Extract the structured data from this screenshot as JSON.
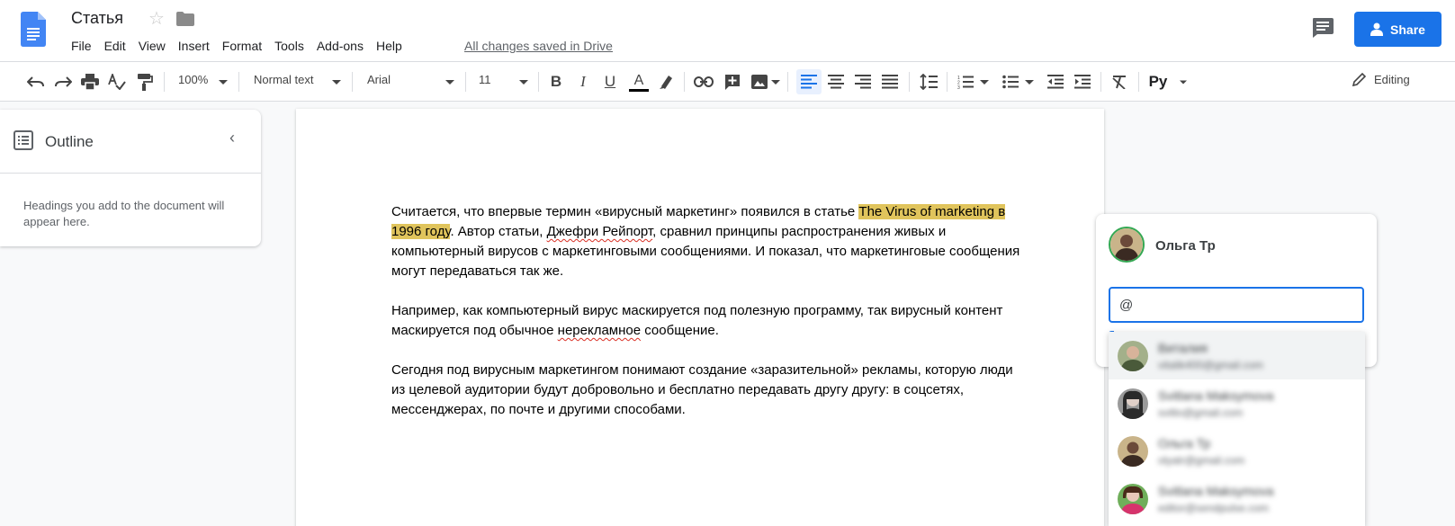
{
  "header": {
    "title": "Статья",
    "menu": [
      "File",
      "Edit",
      "View",
      "Insert",
      "Format",
      "Tools",
      "Add-ons",
      "Help"
    ],
    "saved_status": "All changes saved in Drive",
    "share_label": "Share"
  },
  "toolbar": {
    "zoom": "100%",
    "style": "Normal text",
    "font": "Arial",
    "font_size": "11",
    "mode": "Editing"
  },
  "outline": {
    "title": "Outline",
    "hint": "Headings you add to the document will appear here."
  },
  "document": {
    "p1_a": "Считается, что впервые термин «вирусный маркетинг» появился в статье ",
    "p1_highlight": "The Virus of marketing в 1996 году",
    "p1_b": ". Автор статьи, ",
    "p1_author": "Джефри Рейпорт",
    "p1_c": ", сравнил принципы распространения живых и компьютерный вирусов с маркетинговыми сообщениями. И показал, что маркетинговые сообщения могут передаваться так же.",
    "p2_a": "Например, как компьютерный вирус маскируется под полезную программу, так вирусный контент маскируется под обычное ",
    "p2_spell": "нерекламное",
    "p2_b": " сообщение.",
    "p3": "Сегодня под вирусным маркетингом понимают создание «заразительной» рекламы, которую люди из целевой аудитории будут добровольно и бесплатно передавать другу другу: в соцсетях, мессенджерах, по почте и другими способами."
  },
  "comment": {
    "author": "Ольга Тр",
    "input_value": "@"
  },
  "mentions": [
    {
      "name": "Виталия",
      "email": "vitalik400@gmail.com"
    },
    {
      "name": "Svitlana Maksymova",
      "email": "svitlo@gmail.com"
    },
    {
      "name": "Ольга Тр",
      "email": "olyatr@gmail.com"
    },
    {
      "name": "Svitlana Maksymova",
      "email": "editor@sendpulse.com"
    }
  ],
  "colors": {
    "accent": "#1a73e8",
    "highlight": "#e0c45c",
    "text_color_bar": "#000000"
  }
}
